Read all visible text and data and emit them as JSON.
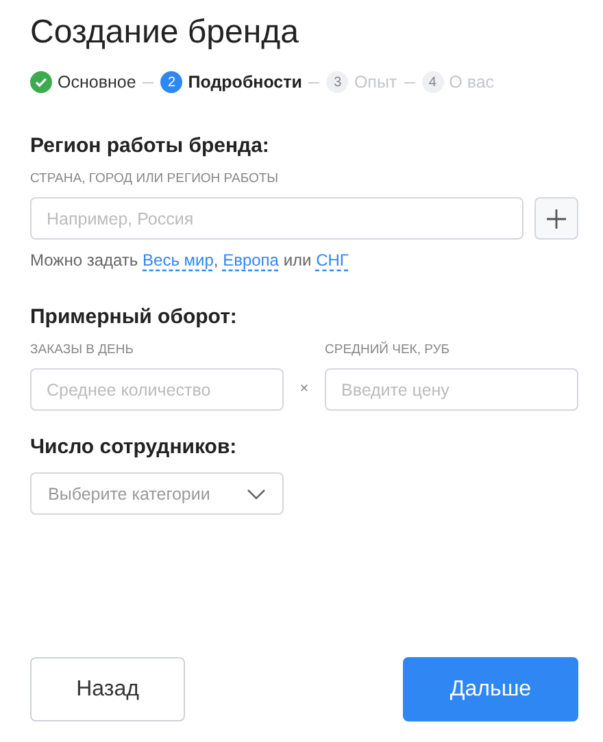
{
  "title": "Создание бренда",
  "steps": [
    {
      "kind": "done",
      "label": "Основное"
    },
    {
      "kind": "current",
      "number": "2",
      "label": "Подробности"
    },
    {
      "kind": "todo",
      "number": "3",
      "label": "Опыт"
    },
    {
      "kind": "todo",
      "number": "4",
      "label": "О вас"
    }
  ],
  "region": {
    "heading": "Регион работы бренда:",
    "label": "СТРАНА, ГОРОД ИЛИ РЕГИОН РАБОТЫ",
    "placeholder": "Например, Россия",
    "hint": [
      {
        "text": "Можно задать ",
        "link": false
      },
      {
        "text": "Весь мир",
        "link": true
      },
      {
        "text": ", ",
        "link": false
      },
      {
        "text": "Европа",
        "link": true
      },
      {
        "text": " или ",
        "link": false
      },
      {
        "text": "СНГ",
        "link": true
      }
    ]
  },
  "turnover": {
    "heading": "Примерный оборот:",
    "orders_label": "ЗАКАЗЫ В ДЕНЬ",
    "orders_placeholder": "Среднее количество",
    "times": "×",
    "check_label": "СРЕДНИЙ ЧЕК, РУБ",
    "check_placeholder": "Введите цену"
  },
  "staff": {
    "heading": "Число сотрудников:",
    "placeholder": "Выберите категории"
  },
  "buttons": {
    "back": "Назад",
    "next": "Дальше"
  }
}
